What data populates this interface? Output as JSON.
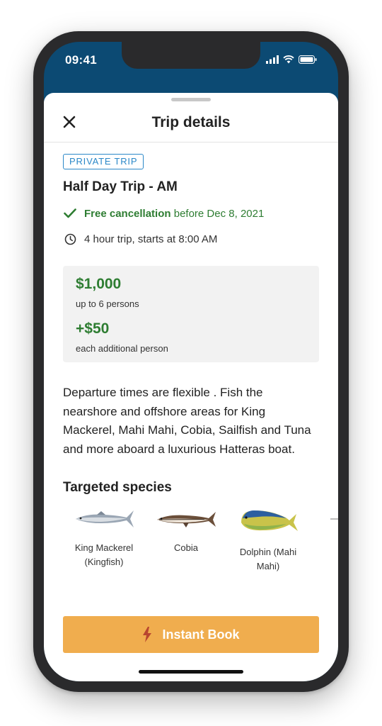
{
  "status_bar": {
    "time": "09:41"
  },
  "sheet": {
    "title": "Trip details"
  },
  "trip": {
    "badge": "PRIVATE TRIP",
    "name": "Half Day Trip - AM",
    "cancellation_bold": "Free cancellation",
    "cancellation_rest": " before Dec 8, 2021",
    "duration": "4 hour trip, starts at 8:00 AM"
  },
  "pricing": {
    "price": "$1,000",
    "price_note": "up to 6 persons",
    "extra_price": "+$50",
    "extra_note": "each additional person"
  },
  "description": "Departure times are flexible . Fish the nearshore and offshore areas for King Mackerel, Mahi Mahi, Cobia, Sailfish and Tuna and more aboard a luxurious Hatteras boat.",
  "species_section": {
    "title": "Targeted species",
    "items": [
      {
        "label": "King Mackerel (Kingfish)",
        "icon": "king-mackerel-icon"
      },
      {
        "label": "Cobia",
        "icon": "cobia-icon"
      },
      {
        "label": "Dolphin (Mahi Mahi)",
        "icon": "dolphin-icon"
      }
    ]
  },
  "cta": {
    "label": "Instant Book",
    "icon": "lightning-icon"
  },
  "colors": {
    "accent_green": "#2e7d32",
    "cta_orange": "#f0ad4e",
    "badge_blue": "#2b88c8",
    "header_navy": "#0c4a73"
  }
}
